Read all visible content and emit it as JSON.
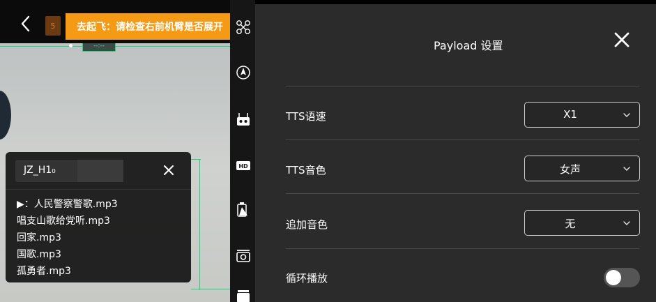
{
  "feed": {
    "badge_number": "5",
    "warning_text": "去起飞：请检查右前机臂是否展开",
    "overlay_box_text": "--:--"
  },
  "playlist": {
    "device_tag": "JZ_H1₀",
    "items": [
      "▶：人民警察警歌.mp3",
      "唱支山歌给党听.mp3",
      "回家.mp3",
      "国歌.mp3",
      "孤勇者.mp3"
    ]
  },
  "strip_icons": [
    "drone-icon",
    "compass-icon",
    "remote-controller-icon",
    "hd-icon",
    "battery-icon",
    "camera-icon",
    "payload-icon"
  ],
  "settings": {
    "title": "Payload 设置",
    "rows": [
      {
        "label": "TTS语速",
        "value": "X1"
      },
      {
        "label": "TTS音色",
        "value": "女声"
      },
      {
        "label": "追加音色",
        "value": "无"
      },
      {
        "label": "循环播放",
        "toggle_on": false
      }
    ]
  },
  "colors": {
    "warning": "#f59a15",
    "accent_green": "#26d07c",
    "panel": "#2b2b2b"
  }
}
